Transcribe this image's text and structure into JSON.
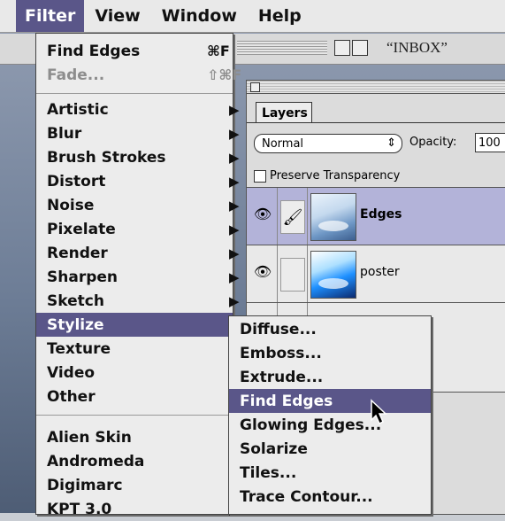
{
  "menubar": {
    "items": [
      "Filter",
      "View",
      "Window",
      "Help"
    ]
  },
  "window": {
    "title": "“INBOX”"
  },
  "layers_palette": {
    "tab": "Layers",
    "blend_mode": "Normal",
    "opacity_label": "Opacity:",
    "opacity_value": "100",
    "preserve_label": "Preserve Transparency",
    "layers": [
      {
        "name": "Edges",
        "selected": true
      },
      {
        "name": "poster",
        "selected": false
      }
    ]
  },
  "filter_menu": {
    "top_items": [
      {
        "label": "Find Edges",
        "shortcut": "⌘F",
        "enabled": true
      },
      {
        "label": "Fade...",
        "shortcut": "⇧⌘F",
        "enabled": false
      }
    ],
    "submenus": [
      "Artistic",
      "Blur",
      "Brush Strokes",
      "Distort",
      "Noise",
      "Pixelate",
      "Render",
      "Sharpen",
      "Sketch",
      "Stylize",
      "Texture",
      "Video",
      "Other"
    ],
    "plugins": [
      "Alien Skin",
      "Andromeda",
      "Digimarc",
      "KPT 3.0"
    ],
    "highlighted": "Stylize"
  },
  "stylize_menu": {
    "items": [
      "Diffuse...",
      "Emboss...",
      "Extrude...",
      "Find Edges",
      "Glowing Edges...",
      "Solarize",
      "Tiles...",
      "Trace Contour..."
    ],
    "highlighted": "Find Edges"
  },
  "colors": {
    "highlight": "#5a5689",
    "menu_bg": "#ececec"
  }
}
